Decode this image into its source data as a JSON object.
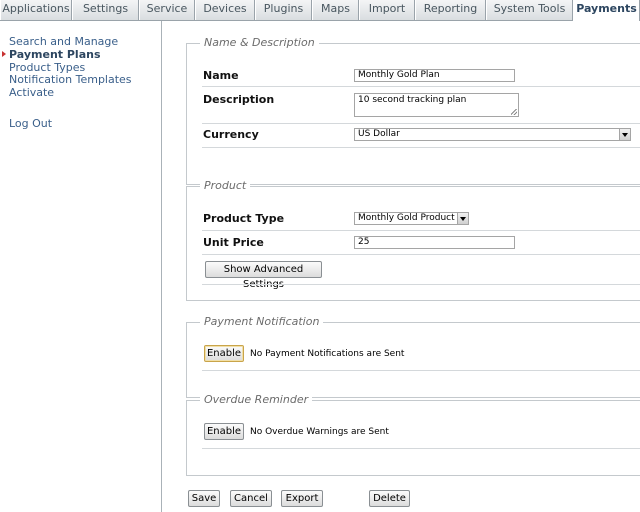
{
  "tabs": [
    {
      "label": "Applications",
      "active": false
    },
    {
      "label": "Settings",
      "active": false
    },
    {
      "label": "Service",
      "active": false
    },
    {
      "label": "Devices",
      "active": false
    },
    {
      "label": "Plugins",
      "active": false
    },
    {
      "label": "Maps",
      "active": false
    },
    {
      "label": "Import",
      "active": false
    },
    {
      "label": "Reporting",
      "active": false
    },
    {
      "label": "System Tools",
      "active": false
    },
    {
      "label": "Payments",
      "active": true
    }
  ],
  "sidebar": {
    "items": [
      {
        "label": "Search and Manage"
      },
      {
        "label": "Payment Plans"
      },
      {
        "label": "Product Types"
      },
      {
        "label": "Notification Templates"
      },
      {
        "label": "Activate"
      }
    ],
    "logout": "Log Out"
  },
  "name_section": {
    "legend": "Name & Description",
    "name_label": "Name",
    "name_value": "Monthly Gold Plan",
    "description_label": "Description",
    "description_value": "10 second tracking plan",
    "currency_label": "Currency",
    "currency_value": "US Dollar"
  },
  "product_section": {
    "legend": "Product",
    "type_label": "Product Type",
    "type_value": "Monthly Gold Product",
    "price_label": "Unit Price",
    "price_value": "25",
    "advanced_button": "Show Advanced Settings"
  },
  "payment_notification": {
    "legend": "Payment Notification",
    "button": "Enable",
    "status": "No Payment Notifications are Sent"
  },
  "overdue_reminder": {
    "legend": "Overdue Reminder",
    "button": "Enable",
    "status": "No Overdue Warnings are Sent"
  },
  "actions": {
    "save": "Save",
    "cancel": "Cancel",
    "export": "Export",
    "delete": "Delete"
  }
}
